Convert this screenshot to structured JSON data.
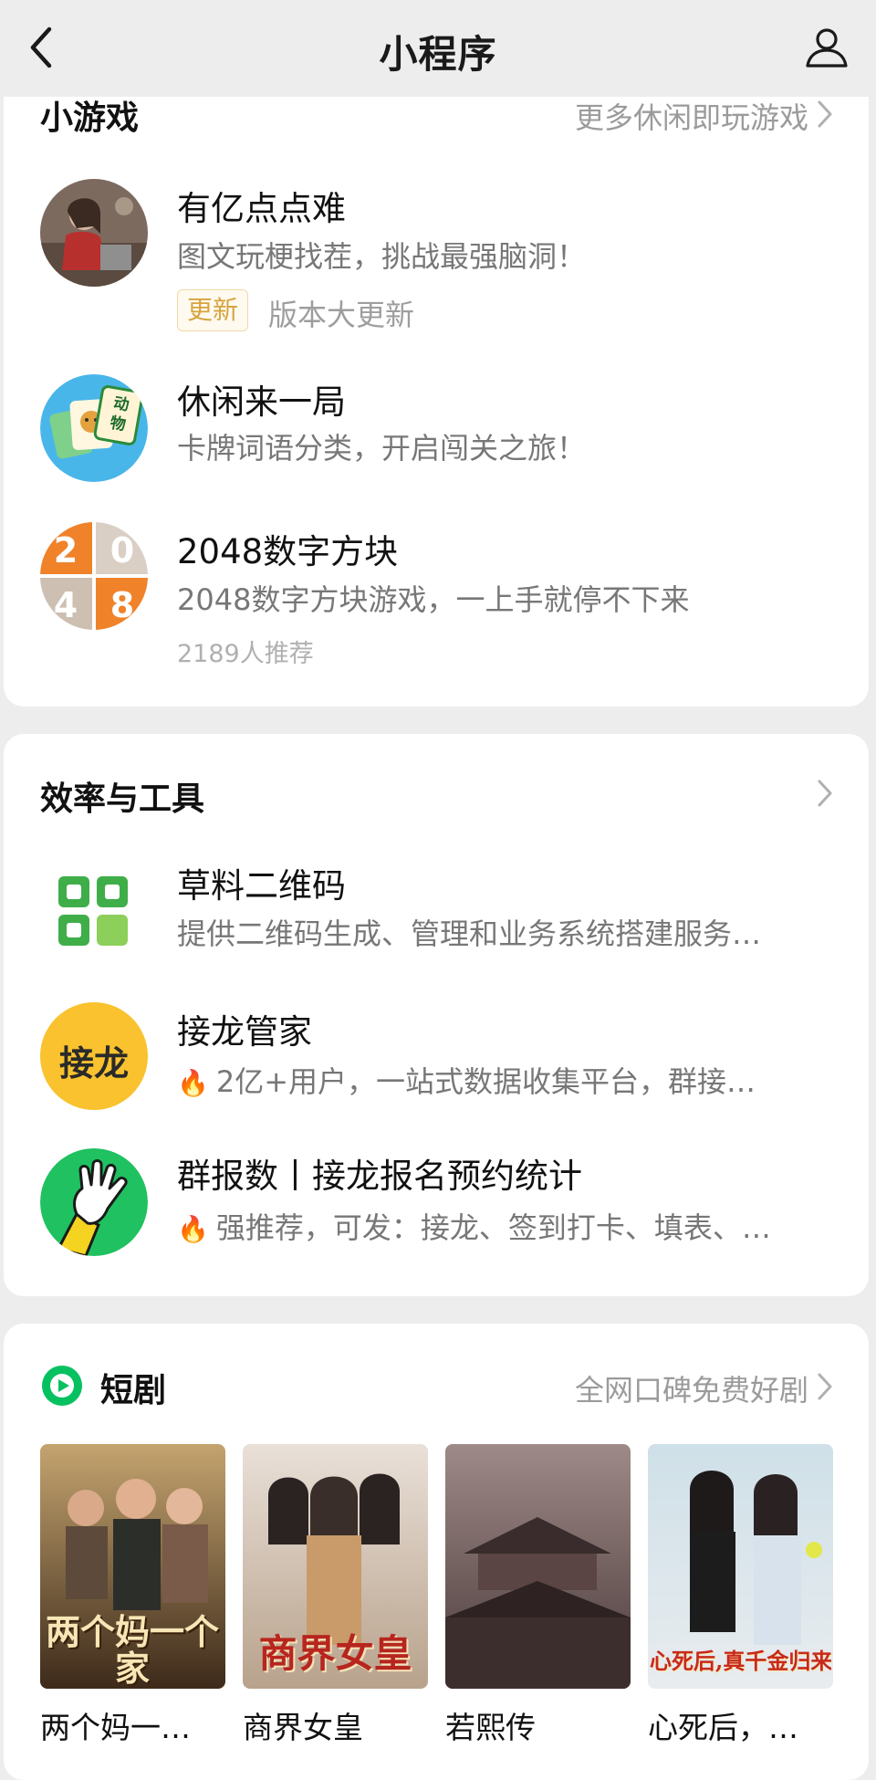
{
  "nav": {
    "title": "小程序",
    "back_icon": "chevron-left-icon",
    "user_icon": "user-icon"
  },
  "games": {
    "title": "小游戏",
    "more": "更多休闲即玩游戏",
    "items": [
      {
        "name": "有亿点点难",
        "desc": "图文玩梗找茬，挑战最强脑洞！",
        "badge": "更新",
        "badge_text": "版本大更新"
      },
      {
        "name": "休闲来一局",
        "desc": "卡牌词语分类，开启闯关之旅！",
        "icon_text": "动物"
      },
      {
        "name": "2048数字方块",
        "desc": "2048数字方块游戏，一上手就停不下来",
        "meta": "2189人推荐",
        "icon_digits": [
          "2",
          "0",
          "4",
          "8"
        ]
      }
    ]
  },
  "tools": {
    "title": "效率与工具",
    "items": [
      {
        "name": "草料二维码",
        "desc": "提供二维码生成、管理和业务系统搭建服务…"
      },
      {
        "name": "接龙管家",
        "desc": "2亿+用户，一站式数据收集平台，群接…",
        "icon_text": "接龙"
      },
      {
        "name": "群报数丨接龙报名预约统计",
        "desc": "强推荐，可发：接龙、签到打卡、填表、…"
      }
    ]
  },
  "drama": {
    "title": "短剧",
    "more": "全网口碑免费好剧",
    "items": [
      {
        "title": "两个妈一…",
        "poster_text": "两个妈一个家"
      },
      {
        "title": "商界女皇",
        "poster_text": "商界女皇"
      },
      {
        "title": "若熙传"
      },
      {
        "title": "心死后，…",
        "poster_text": "心死后,真千金归来"
      }
    ]
  },
  "colors": {
    "accent": "#07c160",
    "badge": "#d6a43f",
    "background": "#ededed"
  }
}
